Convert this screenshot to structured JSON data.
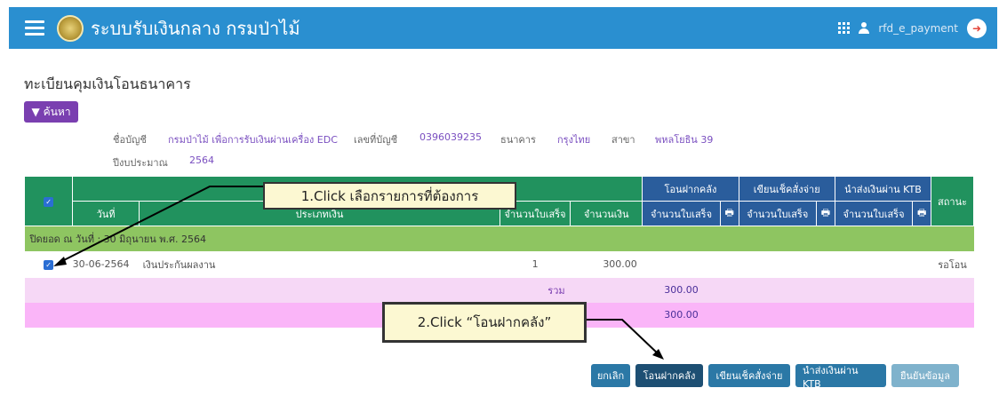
{
  "app": {
    "title": "ระบบรับเงินกลาง กรมป่าไม้",
    "username": "rfd_e_payment"
  },
  "page": {
    "title": "ทะเบียนคุมเงินโอนธนาคาร",
    "search_label": "ค้นหา"
  },
  "account": {
    "name_label": "ชื่อบัญชี",
    "name_value": "กรมป่าไม้ เพื่อการรับเงินผ่านเครื่อง EDC",
    "number_label": "เลขที่บัญชี",
    "number_value": "0396039235",
    "bank_label": "ธนาคาร",
    "bank_value": "กรุงไทย",
    "branch_label": "สาขา",
    "branch_value": "พหลโยธิน 39",
    "year_label": "ปีงบประมาณ",
    "year_value": "2564"
  },
  "table": {
    "headers": {
      "date": "วันที่",
      "type": "ประเภทเงิน",
      "receipts": "จำนวนใบเสร็จ",
      "amount": "จำนวนเงิน",
      "status": "สถานะ"
    },
    "groups": {
      "transfer": "โอนฝากคลัง",
      "cheque": "เขียนเช็คสั่งจ่าย",
      "ktb": "นำส่งเงินผ่าน KTB"
    },
    "sub_receipts": "จำนวนใบเสร็จ",
    "group_row": "ปิดยอด ณ วันที่ : 30 มิถุนายน พ.ศ. 2564",
    "row": {
      "date": "30-06-2564",
      "type": "เงินประกันผลงาน",
      "receipts": "1",
      "amount": "300.00",
      "status": "รอโอน",
      "checked": true
    },
    "sum_label": "รวม",
    "sum_value": "300.00",
    "sum2_value": "300.00"
  },
  "callouts": {
    "one": "1.Click เลือกรายการที่ต้องการ",
    "two": "2.Click “โอนฝากคลัง”"
  },
  "buttons": {
    "cancel": "ยกเลิก",
    "transfer": "โอนฝากคลัง",
    "cheque": "เขียนเช็คสั่งจ่าย",
    "ktb": "นำส่งเงินผ่าน KTB",
    "confirm": "ยืนยันข้อมูล"
  },
  "colors": {
    "topbar": "#2a8fd0",
    "table_header_green": "#21925e",
    "table_header_blue": "#2a5d9c",
    "group_row": "#8ec561",
    "search_button": "#7a3fb0"
  }
}
